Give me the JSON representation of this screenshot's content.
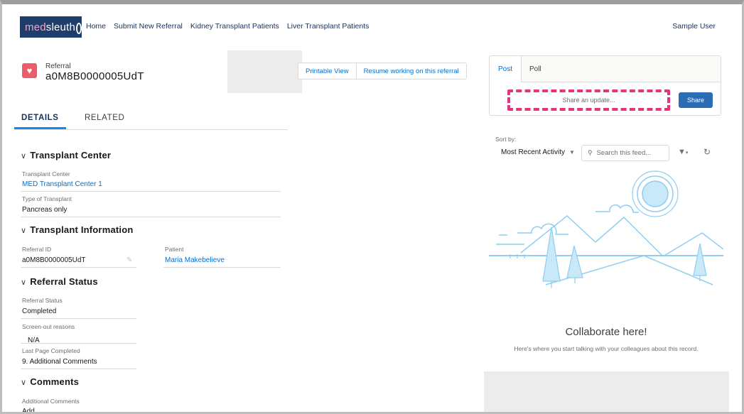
{
  "nav": {
    "logo_med": "med",
    "logo_sleuth": "sleuth",
    "links": [
      "Home",
      "Submit New Referral",
      "Kidney Transplant Patients",
      "Liver Transplant Patients"
    ],
    "user": "Sample User"
  },
  "record": {
    "type": "Referral",
    "name": "a0M8B0000005UdT",
    "buttons": [
      "Printable View",
      "Resume working on this referral"
    ]
  },
  "tabs": {
    "details": "DETAILS",
    "related": "RELATED"
  },
  "sections": {
    "transplant_center": {
      "title": "Transplant Center",
      "center_label": "Transplant Center",
      "center_value": "MED Transplant Center 1",
      "type_label": "Type of Transplant",
      "type_value": "Pancreas only"
    },
    "transplant_info": {
      "title": "Transplant Information",
      "referral_id_label": "Referral ID",
      "referral_id_value": "a0M8B0000005UdT",
      "patient_label": "Patient",
      "patient_value": "Maria Makebelieve"
    },
    "referral_status": {
      "title": "Referral Status",
      "status_label": "Referral Status",
      "status_value": "Completed",
      "screen_label": "Screen-out reasons",
      "screen_value": "N/A",
      "last_page_label": "Last Page Completed",
      "last_page_value": "9. Additional Comments"
    },
    "comments": {
      "title": "Comments",
      "additional_label": "Additional Comments",
      "additional_value": "Add"
    }
  },
  "publisher": {
    "tab_post": "Post",
    "tab_poll": "Poll",
    "placeholder": "Share an update...",
    "share_button": "Share"
  },
  "feed": {
    "sort_label": "Sort by:",
    "sort_value": "Most Recent Activity",
    "search_placeholder": "Search this feed...",
    "empty_title": "Collaborate here!",
    "empty_subtitle": "Here's where you start talking with your colleagues about this record."
  },
  "colors": {
    "brand": "#1f3d6b",
    "link": "#0070d2",
    "record_icon": "#ea5d6a",
    "share_button": "#2a6db5",
    "highlight": "#e8327c",
    "illustration": "#8fcdf1"
  }
}
